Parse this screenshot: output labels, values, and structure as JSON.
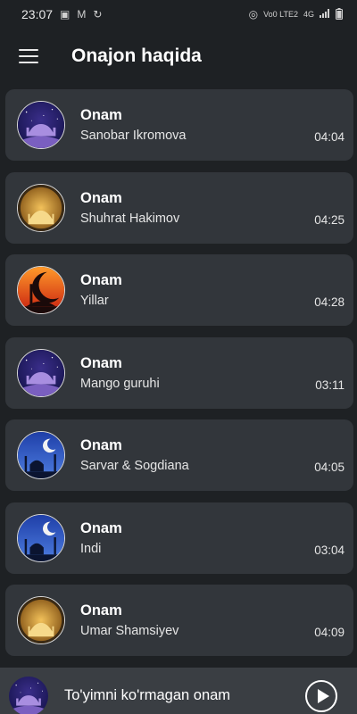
{
  "status_bar": {
    "time": "23:07",
    "left_icons": [
      "image-icon",
      "gmail-icon",
      "sync-icon"
    ],
    "right_icons": [
      "hotspot-icon",
      "volte-icon",
      "4g-icon",
      "signal-icon",
      "battery-icon"
    ],
    "network_label_1": "Vo0 LTE2",
    "network_label_2": "4G"
  },
  "app_bar": {
    "menu_icon": "hamburger-menu-icon",
    "title": "Onajon haqida"
  },
  "songs": [
    {
      "title": "Onam",
      "artist": "Sanobar Ikromova",
      "duration": "04:04",
      "art": "mosque-night-purple"
    },
    {
      "title": "Onam",
      "artist": "Shuhrat Hakimov",
      "duration": "04:25",
      "art": "mosque-crescent-gold"
    },
    {
      "title": "Onam",
      "artist": "Yillar",
      "duration": "04:28",
      "art": "mosque-crescent-red"
    },
    {
      "title": "Onam",
      "artist": "Mango guruhi",
      "duration": "03:11",
      "art": "mosque-night-purple"
    },
    {
      "title": "Onam",
      "artist": "Sarvar & Sogdiana",
      "duration": "04:05",
      "art": "mosque-crescent-blue"
    },
    {
      "title": "Onam",
      "artist": "Indi",
      "duration": "03:04",
      "art": "mosque-crescent-blue"
    },
    {
      "title": "Onam",
      "artist": "Umar Shamsiyev",
      "duration": "04:09",
      "art": "mosque-crescent-gold"
    }
  ],
  "player": {
    "now_playing": "To'yimni ko'rmagan onam",
    "art": "mosque-night-purple",
    "play_icon": "play-circle-icon"
  },
  "colors": {
    "background": "#1e2124",
    "card": "#32363b",
    "player_bar": "#3a3e43",
    "text_primary": "#ffffff",
    "text_secondary": "#e6e6e6"
  }
}
